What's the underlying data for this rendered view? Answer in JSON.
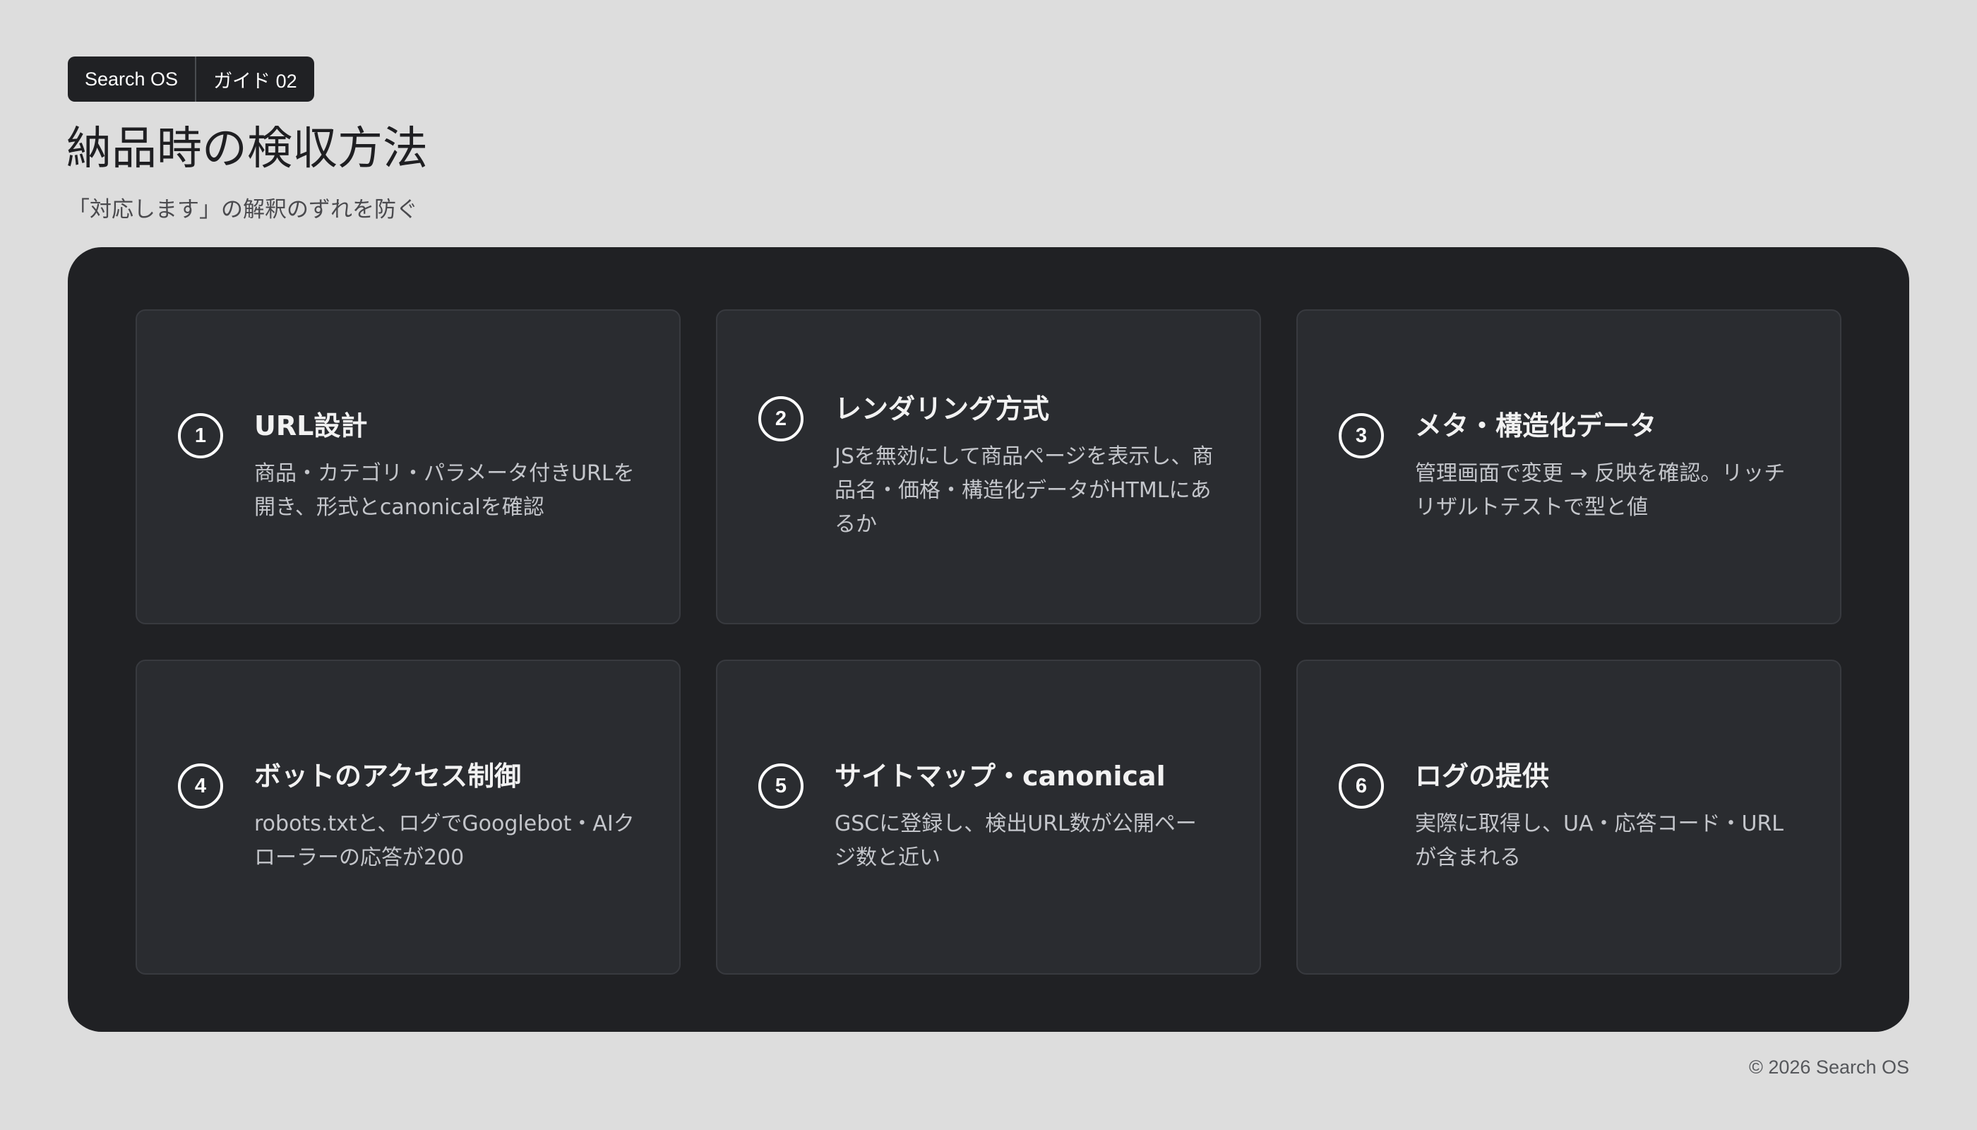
{
  "header": {
    "badge": [
      "Search OS",
      "ガイド 02"
    ],
    "title": "納品時の検収方法",
    "subtitle": "「対応します」の解釈のずれを防ぐ"
  },
  "cards": [
    {
      "number": "1",
      "title": "URL設計",
      "desc": "商品・カテゴリ・パラメータ付きURLを開き、形式とcanonicalを確認"
    },
    {
      "number": "2",
      "title": "レンダリング方式",
      "desc": "JSを無効にして商品ページを表示し、商品名・価格・構造化データがHTMLにあるか"
    },
    {
      "number": "3",
      "title": "メタ・構造化データ",
      "desc": "管理画面で変更 → 反映を確認。リッチリザルトテストで型と値"
    },
    {
      "number": "4",
      "title": "ボットのアクセス制御",
      "desc": "robots.txtと、ログでGooglebot・AIクローラーの応答が200"
    },
    {
      "number": "5",
      "title": "サイトマップ・canonical",
      "desc": "GSCに登録し、検出URL数が公開ページ数と近い"
    },
    {
      "number": "6",
      "title": "ログの提供",
      "desc": "実際に取得し、UA・応答コード・URLが含まれる"
    }
  ],
  "footer": {
    "copyright": "© 2026 Search OS"
  },
  "colors": {
    "background": "#dddddd",
    "panel": "#202124",
    "card": "#2a2c30",
    "card_border": "#383a3f",
    "title_text": "#1f1f22"
  }
}
